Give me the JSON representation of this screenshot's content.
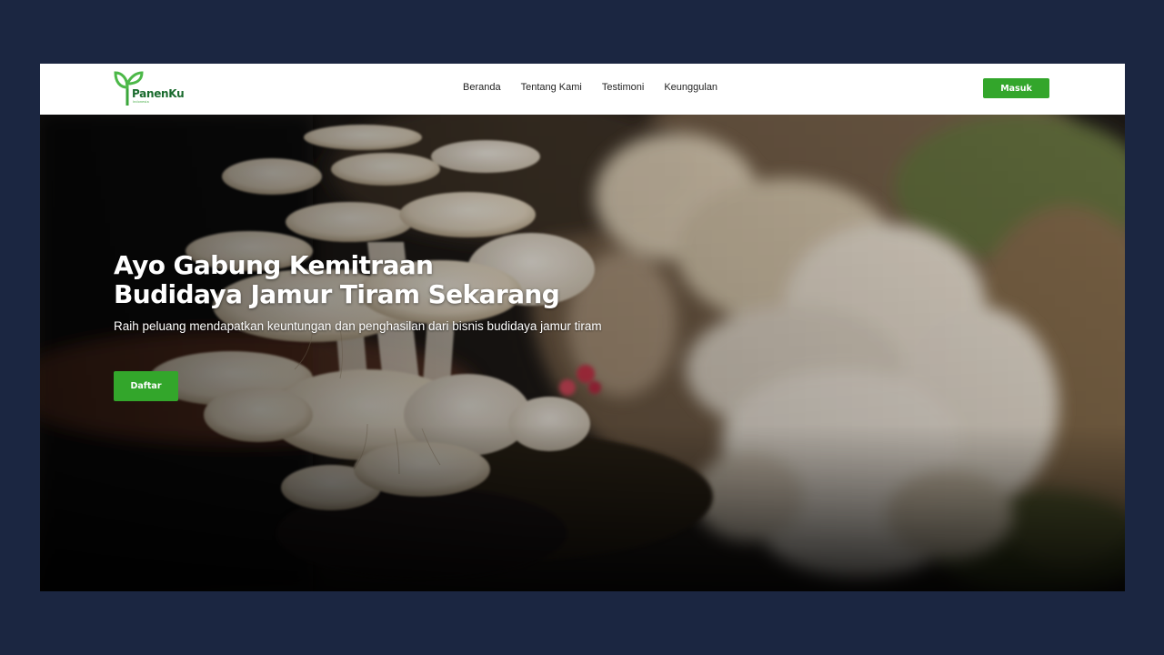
{
  "navbar": {
    "logo_name": "PanenKu",
    "logo_sub": "Indonesia",
    "links": [
      "Beranda",
      "Tentang Kami",
      "Testimoni",
      "Keunggulan"
    ],
    "login_label": "Masuk"
  },
  "hero": {
    "title_line1": "Ayo Gabung Kemitraan",
    "title_line2": "Budidaya Jamur Tiram Sekarang",
    "subtitle": "Raih peluang mendapatkan keuntungan dan penghasilan dari bisnis budidaya jamur tiram",
    "cta_label": "Daftar"
  },
  "colors": {
    "page_background": "#1b2641",
    "brand_green": "#33a62b",
    "logo_dark_green": "#1a6b2e"
  }
}
